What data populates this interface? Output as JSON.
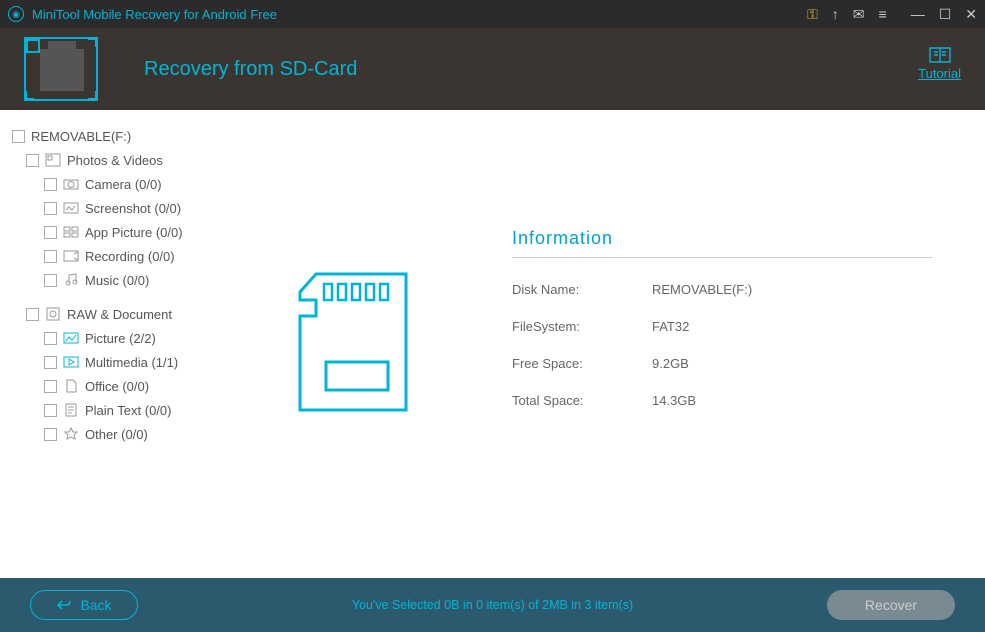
{
  "app": {
    "title": "MiniTool Mobile Recovery for Android Free"
  },
  "header": {
    "title": "Recovery from SD-Card",
    "tutorial": "Tutorial"
  },
  "sidebar": {
    "drive_label": "REMOVABLE(F:)",
    "group_photos": "Photos & Videos",
    "cam": "Camera (0/0)",
    "scr": "Screenshot (0/0)",
    "appp": "App Picture (0/0)",
    "rec": "Recording (0/0)",
    "mus": "Music (0/0)",
    "group_raw": "RAW & Document",
    "pic": "Picture (2/2)",
    "mm": "Multimedia (1/1)",
    "off": "Office (0/0)",
    "pt": "Plain Text (0/0)",
    "oth": "Other (0/0)"
  },
  "info": {
    "heading": "Information",
    "disk_name_k": "Disk Name:",
    "disk_name_v": "REMOVABLE(F:)",
    "fs_k": "FileSystem:",
    "fs_v": "FAT32",
    "free_k": "Free Space:",
    "free_v": "9.2GB",
    "total_k": "Total Space:",
    "total_v": "14.3GB"
  },
  "footer": {
    "back": "Back",
    "status": "You've Selected 0B in 0 item(s) of 2MB in 3 item(s)",
    "recover": "Recover"
  }
}
